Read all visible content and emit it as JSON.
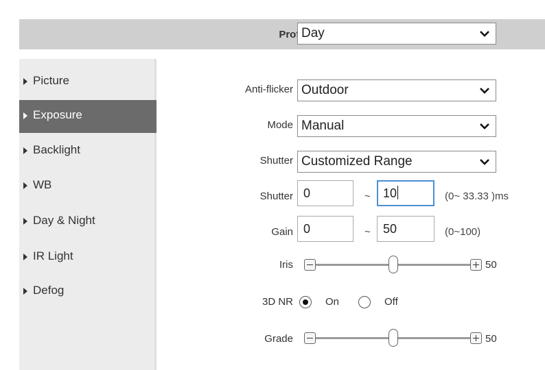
{
  "profile": {
    "label": "Profile",
    "value": "Day"
  },
  "sidebar": {
    "items": [
      {
        "label": "Picture",
        "active": false
      },
      {
        "label": "Exposure",
        "active": true
      },
      {
        "label": "Backlight",
        "active": false
      },
      {
        "label": "WB",
        "active": false
      },
      {
        "label": "Day & Night",
        "active": false
      },
      {
        "label": "IR Light",
        "active": false
      },
      {
        "label": "Defog",
        "active": false
      }
    ]
  },
  "settings": {
    "anti_flicker": {
      "label": "Anti-flicker",
      "value": "Outdoor"
    },
    "mode": {
      "label": "Mode",
      "value": "Manual"
    },
    "shutter_type": {
      "label": "Shutter",
      "value": "Customized Range"
    },
    "shutter_range": {
      "label": "Shutter",
      "min": "0",
      "tilde": "~",
      "max": "10",
      "hint": "(0~ 33.33 )ms"
    },
    "gain_range": {
      "label": "Gain",
      "min": "0",
      "tilde": "~",
      "max": "50",
      "hint": "(0~100)"
    },
    "iris": {
      "label": "Iris",
      "value": "50",
      "level_percent": 50
    },
    "nr3d": {
      "label": "3D NR",
      "on_label": "On",
      "off_label": "Off",
      "selected": "On"
    },
    "grade": {
      "label": "Grade",
      "value": "50",
      "level_percent": 50
    }
  }
}
